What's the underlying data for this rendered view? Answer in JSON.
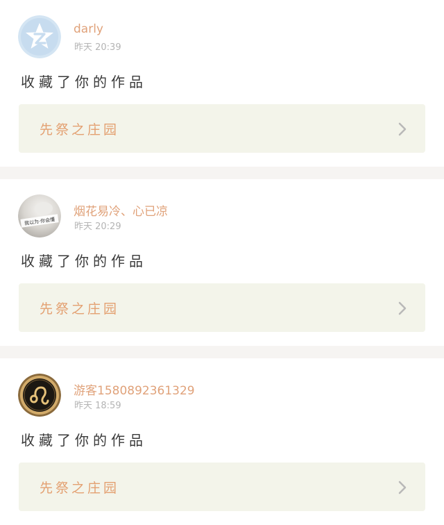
{
  "feed": [
    {
      "username": "darly",
      "time": "昨天 20:39",
      "action": "收藏了你的作品",
      "work_title": "先祭之庄园",
      "avatar_icon": "qzone-star-icon"
    },
    {
      "username": "烟花易冷、心已凉",
      "time": "昨天 20:29",
      "action": "收藏了你的作品",
      "work_title": "先祭之庄园",
      "avatar_icon": "photo-avatar",
      "avatar_text": "我以为·你会懂"
    },
    {
      "username": "游客1580892361329",
      "time": "昨天 18:59",
      "action": "收藏了你的作品",
      "work_title": "先祭之庄园",
      "avatar_icon": "leo-sign-icon"
    }
  ],
  "colors": {
    "username": "#e0a27a",
    "timestamp": "#b4b4b4",
    "card_bg": "#f3f4ea",
    "divider": "#f6f4f2",
    "chevron": "#b8b8b8"
  }
}
